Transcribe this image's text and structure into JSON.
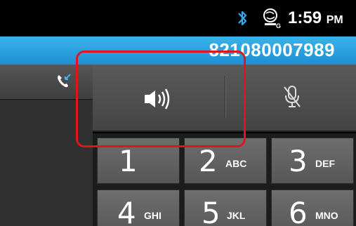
{
  "status_bar": {
    "time": "1:59",
    "ampm": "PM",
    "icons": [
      "bluetooth-icon",
      "sync-icon"
    ]
  },
  "number_bar": {
    "phone_number": "821080007989"
  },
  "left_panel": {
    "icon": "call-transfer-icon"
  },
  "controls": {
    "speaker_icon": "speaker-icon",
    "mute_icon": "mute-icon"
  },
  "keypad": {
    "keys": [
      {
        "digit": "1",
        "letters": ""
      },
      {
        "digit": "2",
        "letters": "ABC"
      },
      {
        "digit": "3",
        "letters": "DEF"
      },
      {
        "digit": "4",
        "letters": "GHI"
      },
      {
        "digit": "5",
        "letters": "JKL"
      },
      {
        "digit": "6",
        "letters": "MNO"
      }
    ]
  },
  "colors": {
    "number_bar": "#1f8fd3",
    "highlight": "#e0141e",
    "call_icon_accent": "#3fb4ef"
  }
}
